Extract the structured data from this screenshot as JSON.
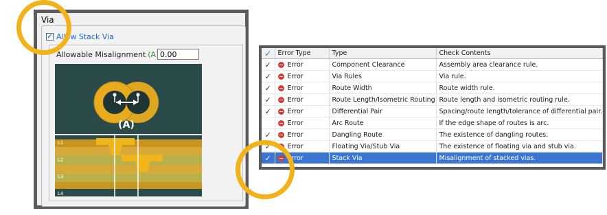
{
  "via_panel": {
    "title": "Via",
    "allow_stack_label": "Allow Stack Via",
    "allow_stack_checked": true,
    "misalignment_label": "Allowable Misalignment",
    "misalignment_marker": "(A)",
    "misalignment_value": "0.00",
    "diagram": {
      "marker_label": "(A)",
      "layers": [
        "L1",
        "L2",
        "L3",
        "L4"
      ]
    }
  },
  "check_table": {
    "columns": [
      "Error Type",
      "Type",
      "Check Contents"
    ],
    "rows": [
      {
        "checked": true,
        "error_type": "Error",
        "type": "Component Clearance",
        "contents": "Assembly area clearance rule."
      },
      {
        "checked": true,
        "error_type": "Error",
        "type": "Via Rules",
        "contents": "Via rule."
      },
      {
        "checked": true,
        "error_type": "Error",
        "type": "Route Width",
        "contents": "Route width rule."
      },
      {
        "checked": true,
        "error_type": "Error",
        "type": "Route Length/Isometric Routing",
        "contents": "Route length and isometric routing rule."
      },
      {
        "checked": true,
        "error_type": "Error",
        "type": "Differential Pair",
        "contents": "Spacing/route length/tolerance of differential pair."
      },
      {
        "checked": false,
        "error_type": "Error",
        "type": "Arc Route",
        "contents": "If the edge shape of routes is arc."
      },
      {
        "checked": true,
        "error_type": "Error",
        "type": "Dangling Route",
        "contents": "The existence of dangling routes."
      },
      {
        "checked": true,
        "error_type": "Error",
        "type": "Floating Via/Stub Via",
        "contents": "The existence of floating via and stub via."
      },
      {
        "checked": true,
        "error_type": "Error",
        "type": "Stack Via",
        "contents": "Misalignment of stacked vias.",
        "selected": true
      }
    ]
  },
  "colors": {
    "accent_ring": "#f2b21a",
    "selection": "#3b74d1",
    "error_icon": "#d83a36",
    "diagram_bg": "#2b4a4a",
    "via_gold": "#e8ab1f"
  },
  "check_mark": "✓"
}
